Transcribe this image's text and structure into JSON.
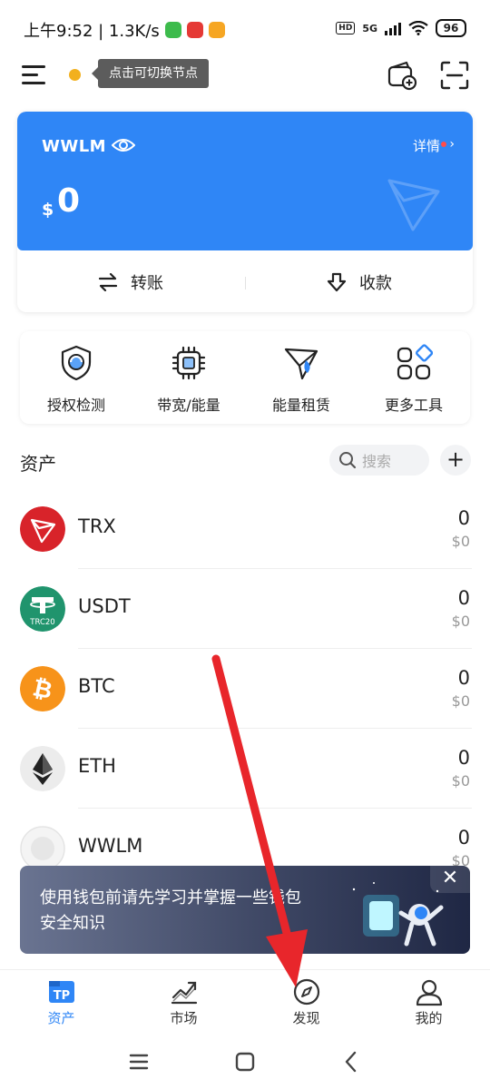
{
  "status_bar": {
    "time_speed": "上午9:52 | 1.3K/s",
    "network": "5G",
    "hd": "HD",
    "battery": "96"
  },
  "header": {
    "node_tooltip": "点击可切换节点"
  },
  "wallet": {
    "name": "WWLM",
    "detail_label": "详情",
    "currency_symbol": "$",
    "balance": "0",
    "transfer_label": "转账",
    "receive_label": "收款",
    "accent_color": "#2f86f6"
  },
  "tools": [
    {
      "label": "授权检测",
      "icon": "shield-scan-icon"
    },
    {
      "label": "带宽/能量",
      "icon": "chip-icon"
    },
    {
      "label": "能量租赁",
      "icon": "energy-rocket-icon"
    },
    {
      "label": "更多工具",
      "icon": "grid-more-icon"
    }
  ],
  "assets": {
    "title": "资产",
    "search_placeholder": "搜索",
    "items": [
      {
        "symbol": "TRX",
        "amount": "0",
        "usd": "$0",
        "color": "#d8232a"
      },
      {
        "symbol": "USDT",
        "amount": "0",
        "usd": "$0",
        "color": "#20946d",
        "badge": "TRC20"
      },
      {
        "symbol": "BTC",
        "amount": "0",
        "usd": "$0",
        "color": "#f7931a"
      },
      {
        "symbol": "ETH",
        "amount": "0",
        "usd": "$0",
        "color": "#ececec"
      },
      {
        "symbol": "WWLM",
        "amount": "0",
        "usd": "$0",
        "color": "#eeeeee"
      }
    ]
  },
  "banner": {
    "text": "使用钱包前请先学习并掌握一些钱包安全知识"
  },
  "tabbar": [
    {
      "label": "资产",
      "active": true,
      "icon": "tp-logo-icon"
    },
    {
      "label": "市场",
      "active": false,
      "icon": "market-chart-icon"
    },
    {
      "label": "发现",
      "active": false,
      "icon": "compass-icon"
    },
    {
      "label": "我的",
      "active": false,
      "icon": "profile-icon"
    }
  ]
}
